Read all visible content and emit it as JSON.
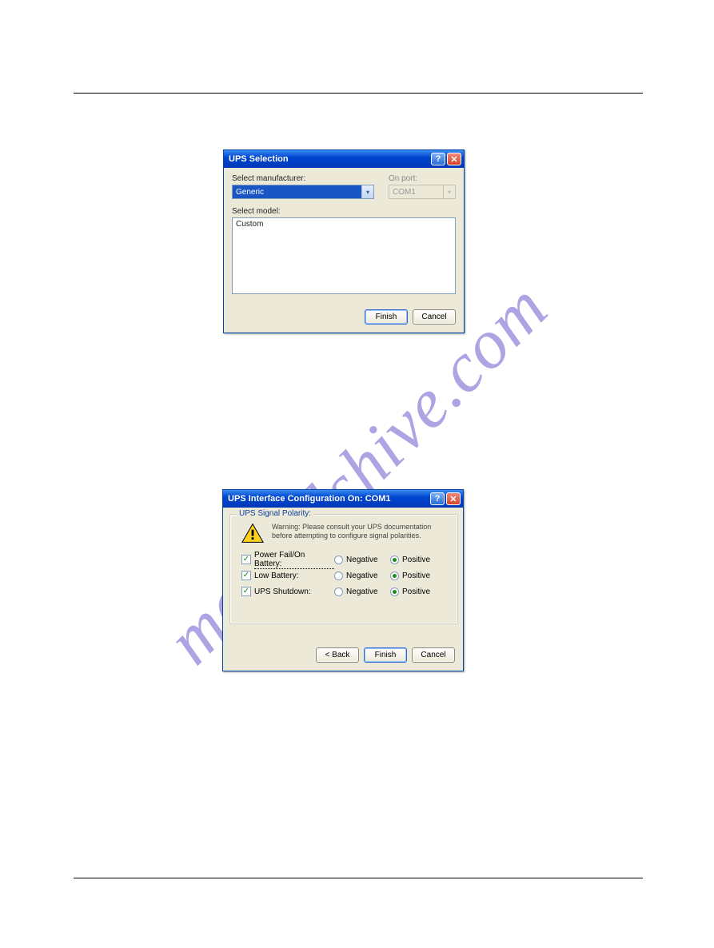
{
  "watermark": "manualshive.com",
  "dialog1": {
    "title": "UPS Selection",
    "manufacturer_label": "Select manufacturer:",
    "manufacturer_value": "Generic",
    "port_label": "On port:",
    "port_value": "COM1",
    "model_label": "Select model:",
    "model_item": "Custom",
    "buttons": {
      "finish": "Finish",
      "cancel": "Cancel"
    }
  },
  "dialog2": {
    "title": "UPS Interface Configuration On: COM1",
    "group_legend": "UPS Signal Polarity:",
    "warning": "Warning: Please consult your UPS documentation before attempting to configure signal polarities.",
    "rows": [
      {
        "label": "Power Fail/On Battery:",
        "checked": true,
        "dotted": true,
        "negative": false,
        "positive": true
      },
      {
        "label": "Low Battery:",
        "checked": true,
        "dotted": false,
        "negative": false,
        "positive": true
      },
      {
        "label": "UPS Shutdown:",
        "checked": true,
        "dotted": false,
        "negative": false,
        "positive": true
      }
    ],
    "neg_label": "Negative",
    "pos_label": "Positive",
    "buttons": {
      "back": "< Back",
      "finish": "Finish",
      "cancel": "Cancel"
    }
  }
}
